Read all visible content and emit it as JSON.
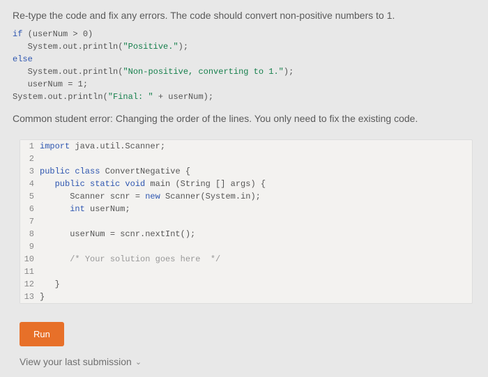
{
  "instruction": "Re-type the code and fix any errors. The code should convert non-positive numbers to 1.",
  "sample": {
    "l1_kw": "if",
    "l1_rest": " (userNum > 0)",
    "l2_pre": "   System.out.println(",
    "l2_str": "\"Positive.\"",
    "l2_post": ");",
    "l3_kw": "else",
    "l4_pre": "   System.out.println(",
    "l4_str": "\"Non-positive, converting to 1.\"",
    "l4_post": ");",
    "l5": "   userNum = 1;",
    "l6_pre": "System.out.println(",
    "l6_str": "\"Final: \"",
    "l6_post": " + userNum);"
  },
  "common_error": "Common student error: Changing the order of the lines. You only need to fix the existing code.",
  "editor": {
    "lines": [
      {
        "n": "1",
        "parts": [
          {
            "t": "import",
            "c": "ed-kw"
          },
          {
            "t": " java.util.Scanner;"
          }
        ]
      },
      {
        "n": "2",
        "parts": []
      },
      {
        "n": "3",
        "parts": [
          {
            "t": "public class",
            "c": "ed-kw"
          },
          {
            "t": " ConvertNegative {"
          }
        ]
      },
      {
        "n": "4",
        "parts": [
          {
            "t": "   "
          },
          {
            "t": "public static void",
            "c": "ed-kw"
          },
          {
            "t": " main (String [] args) {"
          }
        ]
      },
      {
        "n": "5",
        "parts": [
          {
            "t": "      Scanner scnr = "
          },
          {
            "t": "new",
            "c": "ed-kw"
          },
          {
            "t": " Scanner(System.in);"
          }
        ]
      },
      {
        "n": "6",
        "parts": [
          {
            "t": "      "
          },
          {
            "t": "int",
            "c": "ed-type"
          },
          {
            "t": " userNum;"
          }
        ]
      },
      {
        "n": "7",
        "parts": []
      },
      {
        "n": "8",
        "parts": [
          {
            "t": "      userNum = scnr.nextInt();"
          }
        ]
      },
      {
        "n": "9",
        "parts": []
      },
      {
        "n": "10",
        "parts": [
          {
            "t": "      "
          },
          {
            "t": "/* Your solution goes here  */",
            "c": "ed-comment"
          }
        ]
      },
      {
        "n": "11",
        "parts": []
      },
      {
        "n": "12",
        "parts": [
          {
            "t": "   }"
          }
        ]
      },
      {
        "n": "13",
        "parts": [
          {
            "t": "}"
          }
        ]
      }
    ]
  },
  "run_label": "Run",
  "view_submission": "View your last submission"
}
